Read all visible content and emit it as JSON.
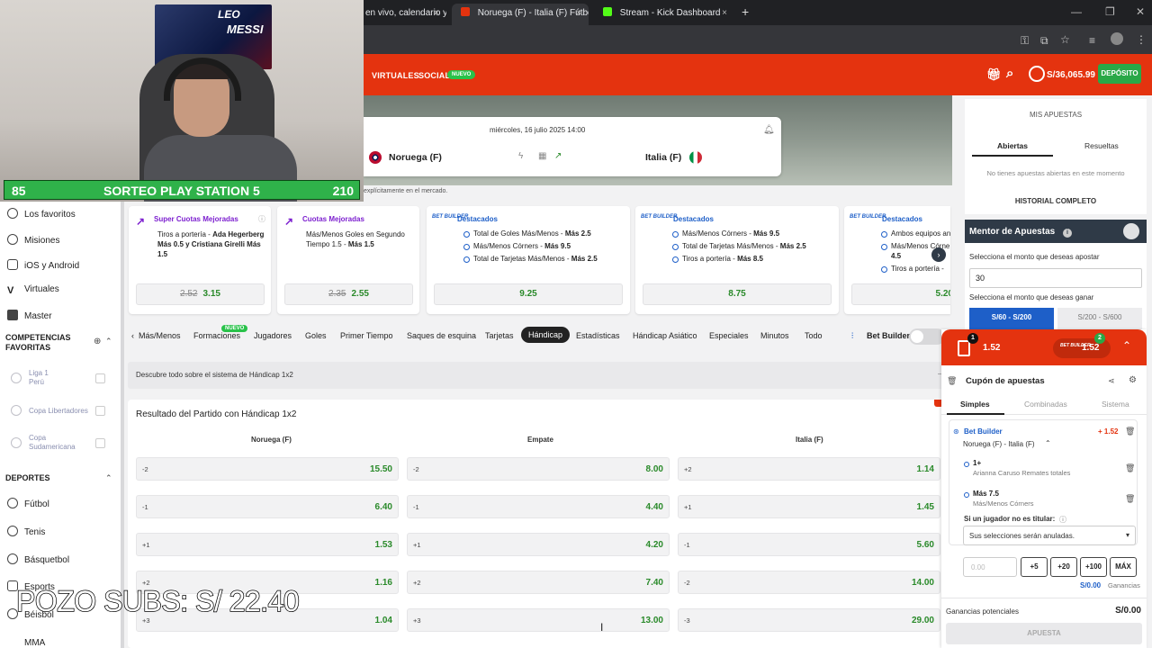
{
  "browser": {
    "tabs": [
      {
        "label": "en vivo, calendario y",
        "icon_color": "#888888"
      },
      {
        "label": "Noruega (F) - Italia (F) Fútbol C",
        "icon_color": "#e4330f"
      },
      {
        "label": "Stream - Kick Dashboard",
        "icon_color": "#53fc18"
      }
    ],
    "new_tab": "+",
    "close": "×"
  },
  "webcam": {
    "poster_text_1": "LEO",
    "poster_text_2": "MESSI",
    "sorteo_left": "85",
    "sorteo_title": "SORTEO PLAY STATION 5",
    "sorteo_right": "210"
  },
  "header": {
    "nav": [
      "VIRTUALES",
      "SOCIAL"
    ],
    "new_badge": "NUEVO",
    "balance": "S/36,065.99",
    "deposit": "DEPÓSITO"
  },
  "event": {
    "date": "miércoles, 16 julio 2025 14:00",
    "home": "Noruega (F)",
    "away": "Italia (F)",
    "note": "explícitamente en el mercado."
  },
  "promos": [
    {
      "title": "Super Cuotas Mejoradas",
      "text_pre": "Tiros a portería - ",
      "text_bold": "Ada Hegerberg Más 0.5 y Cristiana Girelli Más 1.5",
      "old": "2.52",
      "odds": "3.15"
    },
    {
      "title": "Cuotas Mejoradas",
      "text_pre": "Más/Menos Goles en Segundo Tiempo 1.5 - ",
      "text_bold": "Más 1.5",
      "old": "2.35",
      "odds": "2.55"
    },
    {
      "title": "Destacados",
      "sels": [
        {
          "pre": "Total de Goles Más/Menos - ",
          "bold": "Más 2.5"
        },
        {
          "pre": "Más/Menos Córners - ",
          "bold": "Más 9.5"
        },
        {
          "pre": "Total de Tarjetas Más/Menos - ",
          "bold": "Más 2.5"
        }
      ],
      "odds": "9.25"
    },
    {
      "title": "Destacados",
      "sels": [
        {
          "pre": "Más/Menos Córners - ",
          "bold": "Más 9.5"
        },
        {
          "pre": "Total de Tarjetas Más/Menos - ",
          "bold": "Más 2.5"
        },
        {
          "pre": "Tiros a portería - ",
          "bold": "Más 8.5"
        }
      ],
      "odds": "8.75"
    },
    {
      "title": "Destacados",
      "sels": [
        {
          "pre": "Ambos equipos an",
          "bold": ""
        },
        {
          "pre": "Más/Menos Córne",
          "bold": ""
        },
        {
          "pre": "",
          "bold": "4.5"
        },
        {
          "pre": "Tiros a portería -",
          "bold": ""
        }
      ],
      "odds": "5.20"
    }
  ],
  "bet_builder_logo": "BET BUILDER",
  "sidebar": {
    "items": [
      "Los favoritos",
      "Misiones",
      "iOS y Android",
      "Virtuales",
      "Master"
    ],
    "fav_header": "COMPETENCIAS FAVORITAS",
    "competitions": [
      {
        "name": "Liga 1",
        "sub": "Perú"
      },
      {
        "name": "Copa Libertadores",
        "sub": ""
      },
      {
        "name": "Copa",
        "sub": "Sudamericana"
      }
    ],
    "sports_header": "DEPORTES",
    "sports": [
      "Fútbol",
      "Tenis",
      "Básquetbol",
      "Esports",
      "Béisbol",
      "MMA"
    ]
  },
  "market_tabs": {
    "tabs": [
      "Más/Menos",
      "Formaciones",
      "Jugadores",
      "Goles",
      "Primer Tiempo",
      "Saques de esquina",
      "Tarjetas",
      "Hándicap",
      "Estadísticas",
      "Hándicap Asiático",
      "Especiales",
      "Minutos",
      "Todo"
    ],
    "new_badge": "NUEVO",
    "bet_builder": "Bet Builder"
  },
  "info_bar": "Descubre todo sobre el sistema de Hándicap 1x2",
  "market": {
    "title": "Resultado del Partido con Hándicap 1x2",
    "columns": [
      "Noruega (F)",
      "Empate",
      "Italia (F)"
    ],
    "rows": [
      [
        {
          "h": "-2",
          "o": "15.50"
        },
        {
          "h": "-2",
          "o": "8.00"
        },
        {
          "h": "+2",
          "o": "1.14"
        }
      ],
      [
        {
          "h": "-1",
          "o": "6.40"
        },
        {
          "h": "-1",
          "o": "4.40"
        },
        {
          "h": "+1",
          "o": "1.45"
        }
      ],
      [
        {
          "h": "+1",
          "o": "1.53"
        },
        {
          "h": "+1",
          "o": "4.20"
        },
        {
          "h": "-1",
          "o": "5.60"
        }
      ],
      [
        {
          "h": "+2",
          "o": "1.16"
        },
        {
          "h": "+2",
          "o": "7.40"
        },
        {
          "h": "-2",
          "o": "14.00"
        }
      ],
      [
        {
          "h": "+3",
          "o": "1.04"
        },
        {
          "h": "+3",
          "o": "13.00"
        },
        {
          "h": "-3",
          "o": "29.00"
        }
      ]
    ]
  },
  "mybets": {
    "title": "MIS APUESTAS",
    "tab_open": "Abiertas",
    "tab_settled": "Resueltas",
    "empty": "No tienes apuestas abiertas en este momento",
    "history": "HISTORIAL COMPLETO"
  },
  "mentor": {
    "title": "Mentor de Apuestas",
    "q1": "Selecciona el monto que deseas apostar",
    "amount": "30",
    "q2": "Selecciona el monto que deseas ganar",
    "range1": "S/60 - S/200",
    "range2": "S/200 - S/600"
  },
  "coupon": {
    "count": "1",
    "odds": "1.52",
    "bb_count": "2",
    "bb_odds": "1.52",
    "title": "Cupón de apuestas",
    "tabs": [
      "Simples",
      "Combinadas",
      "Sistema"
    ],
    "builder_label": "Bet Builder",
    "builder_odds": "+ 1.52",
    "match": "Noruega (F) - Italia (F)",
    "selections": [
      {
        "pick": "1+",
        "desc": "Arianna Caruso Remates totales"
      },
      {
        "pick": "Más 7.5",
        "desc": "Más/Menos Córners"
      }
    ],
    "titular_q": "Si un jugador no es titular:",
    "titular_value": "Sus selecciones serán anuladas.",
    "stake_placeholder": "0.00",
    "quick": [
      "+5",
      "+20",
      "+100",
      "MÁX"
    ],
    "winnings_small": "S/0.00",
    "winnings_small_label": "Ganancias",
    "potential_label": "Ganancias potenciales",
    "potential_value": "S/0.00",
    "submit": "APUESTA"
  },
  "overlay": "POZO SUBS: S/ 22.40"
}
